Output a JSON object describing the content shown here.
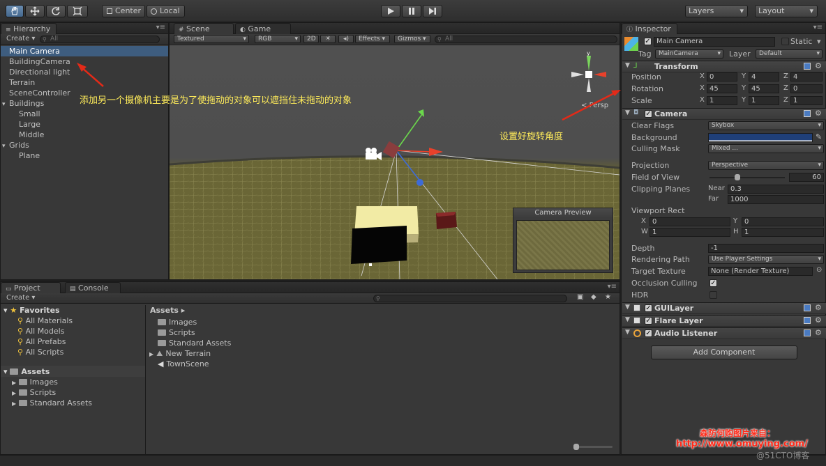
{
  "toolbar": {
    "pivot": "Center",
    "space": "Local",
    "layers": "Layers",
    "layout": "Layout"
  },
  "hierarchy": {
    "tab": "Hierarchy",
    "create": "Create",
    "search_placeholder": "All",
    "items": [
      {
        "label": "Main Camera",
        "indent": 0,
        "selected": true
      },
      {
        "label": "BuildingCamera",
        "indent": 0
      },
      {
        "label": "Directional light",
        "indent": 0
      },
      {
        "label": "Terrain",
        "indent": 0
      },
      {
        "label": "SceneController",
        "indent": 0
      },
      {
        "label": "Buildings",
        "indent": 0,
        "expanded": true
      },
      {
        "label": "Small",
        "indent": 1
      },
      {
        "label": "Large",
        "indent": 1
      },
      {
        "label": "Middle",
        "indent": 1
      },
      {
        "label": "Grids",
        "indent": 0,
        "expanded": true
      },
      {
        "label": "Plane",
        "indent": 1
      }
    ]
  },
  "scene": {
    "tab_scene": "Scene",
    "tab_game": "Game",
    "draw_mode": "Textured",
    "render_mode": "RGB",
    "mode_2d": "2D",
    "effects": "Effects",
    "gizmos": "Gizmos",
    "search_placeholder": "All",
    "persp": "Persp",
    "camera_preview": "Camera Preview"
  },
  "annotations": {
    "hierarchy_note": "添加另一个摄像机主要是为了使拖动的对象可以遮挡住未拖动的对象",
    "rotation_note": "设置好旋转角度"
  },
  "project": {
    "tab_project": "Project",
    "tab_console": "Console",
    "create": "Create",
    "favorites_label": "Favorites",
    "favorites": [
      "All Materials",
      "All Models",
      "All Prefabs",
      "All Scripts"
    ],
    "assets_label": "Assets",
    "asset_tree": [
      "Images",
      "Scripts",
      "Standard Assets"
    ],
    "breadcrumb": "Assets",
    "assets_list": [
      "Images",
      "Scripts",
      "Standard Assets",
      "New Terrain",
      "TownScene"
    ]
  },
  "inspector": {
    "tab": "Inspector",
    "object_name": "Main Camera",
    "static_label": "Static",
    "tag_label": "Tag",
    "tag_value": "MainCamera",
    "layer_label": "Layer",
    "layer_value": "Default",
    "transform": {
      "title": "Transform",
      "position_label": "Position",
      "rotation_label": "Rotation",
      "scale_label": "Scale",
      "position": {
        "x": "0",
        "y": "4",
        "z": "4"
      },
      "rotation": {
        "x": "45",
        "y": "45",
        "z": "0"
      },
      "scale": {
        "x": "1",
        "y": "1",
        "z": "1"
      },
      "x": "X",
      "y": "Y",
      "z": "Z"
    },
    "camera": {
      "title": "Camera",
      "clear_flags_label": "Clear Flags",
      "clear_flags": "Skybox",
      "background_label": "Background",
      "background_color": "#1f3f78",
      "culling_mask_label": "Culling Mask",
      "culling_mask": "Mixed ...",
      "projection_label": "Projection",
      "projection": "Perspective",
      "fov_label": "Field of View",
      "fov": "60",
      "fov_fraction": 0.33,
      "clipping_label": "Clipping Planes",
      "near_label": "Near",
      "near": "0.3",
      "far_label": "Far",
      "far": "1000",
      "viewport_label": "Viewport Rect",
      "vp_x": "0",
      "vp_y": "0",
      "vp_w": "1",
      "vp_h": "1",
      "x": "X",
      "y": "Y",
      "w": "W",
      "h": "H",
      "depth_label": "Depth",
      "depth": "-1",
      "rendering_path_label": "Rendering Path",
      "rendering_path": "Use Player Settings",
      "target_texture_label": "Target Texture",
      "target_texture": "None (Render Texture)",
      "occlusion_label": "Occlusion Culling",
      "hdr_label": "HDR"
    },
    "components": [
      "GUILayer",
      "Flare Layer",
      "Audio Listener"
    ],
    "add_component": "Add Component"
  },
  "watermark": {
    "line1": "森防何购图片来自：",
    "url": "http://www.omuying.com/",
    "blog": "@51CTO博客"
  }
}
